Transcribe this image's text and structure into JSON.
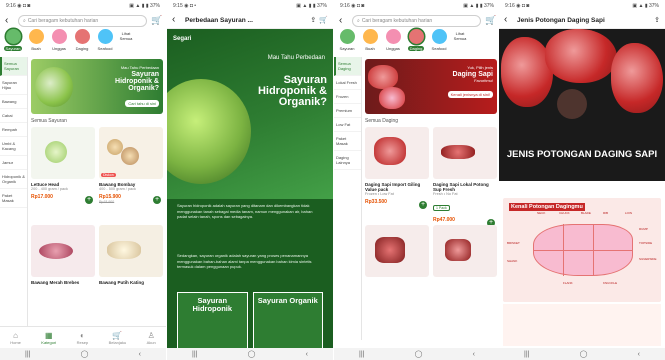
{
  "screens": [
    {
      "status": {
        "time": "9:16 ◉ ◘ ◙",
        "icons": "▣ ▲ ▮ ▮ 37%"
      },
      "search": {
        "placeholder": "Cari beragam kebutuhan harian"
      },
      "categories": [
        {
          "label": "Sayuran",
          "color": "#66bb6a",
          "selected": true
        },
        {
          "label": "Buah",
          "color": "#ffb74d",
          "selected": false
        },
        {
          "label": "Unggas",
          "color": "#f48fb1",
          "selected": false
        },
        {
          "label": "Daging",
          "color": "#e57373",
          "selected": false
        },
        {
          "label": "Seafood",
          "color": "#4fc3f7",
          "selected": false
        }
      ],
      "categories_more": "Lihat Semua",
      "sidebar": [
        "Semua Sayuran",
        "Sayuran Hijau",
        "Bawang",
        "Cabai",
        "Rempah",
        "Umbi & Kacang",
        "Jamur",
        "Hidroponik & Organik",
        "Paket Masak"
      ],
      "banner": {
        "l1": "Mau Tahu Perbedaan",
        "l2": "Sayuran Hidroponik & Organik?",
        "btn": "Cari tahu di sini"
      },
      "section": "Semua Sayuran",
      "products": [
        {
          "name": "Lettuce Head",
          "weight": "200 - 400 gram / pack",
          "price": "Rp17.000",
          "old": "",
          "tag": ""
        },
        {
          "name": "Bawang Bombay",
          "weight": "400 - 500 gram / pack",
          "price": "Rp15.900",
          "old": "Rp18.900",
          "tag": "Diskon"
        },
        {
          "name": "Bawang Merah Brebes",
          "weight": "",
          "price": "",
          "old": "",
          "tag": ""
        },
        {
          "name": "Bawang Putih Kating",
          "weight": "",
          "price": "",
          "old": "",
          "tag": ""
        }
      ],
      "bottomnav": [
        {
          "label": "Home",
          "icon": "⌂"
        },
        {
          "label": "Kategori",
          "icon": "▦"
        },
        {
          "label": "Resep",
          "icon": "◐"
        },
        {
          "label": "Belanjaku",
          "icon": "🛒"
        },
        {
          "label": "Akun",
          "icon": "♙"
        }
      ]
    },
    {
      "status": {
        "time": "9:15 ◉ ◘ •",
        "icons": "▣ ▲ ▮ ▮ 37%"
      },
      "title": "Perbedaan Sayuran ...",
      "logo": "Segari",
      "hero_small": "Mau Tahu Perbedaan",
      "hero_big": "Sayuran Hidroponik & Organik?",
      "para1": "Sayuran hidroponik adalah sayuran yang ditanam dan dikembangkan tidak menggunakan tanah sebagai media tanam, namun menggunakan air, bahan padat selain tanah, spons dan sebagainya.",
      "para2": "Sedangkan, sayuran organik adalah sayuran yang proses penanamannya menggunakan bahan-bahan alami tanpa menggunakan bahan kimia sintetis termasuk dalam penggunaan pupuk.",
      "cmp_left": "Sayuran Hidroponik",
      "cmp_right": "Sayuran Organik"
    },
    {
      "status": {
        "time": "9:16 ◉ ◘ ◙",
        "icons": "▣ ▲ ▮ ▮ 37%"
      },
      "search": {
        "placeholder": "Cari beragam kebutuhan harian"
      },
      "categories": [
        {
          "label": "Sayuran",
          "color": "#66bb6a",
          "selected": false
        },
        {
          "label": "Buah",
          "color": "#ffb74d",
          "selected": false
        },
        {
          "label": "Unggas",
          "color": "#f48fb1",
          "selected": false
        },
        {
          "label": "Daging",
          "color": "#e57373",
          "selected": true
        },
        {
          "label": "Seafood",
          "color": "#4fc3f7",
          "selected": false
        }
      ],
      "categories_more": "Lihat Semua",
      "sidebar": [
        "Semua Daging",
        "Lokal Fresh",
        "Frozen",
        "Premium",
        "Low Fat",
        "Paket Masak",
        "Daging Lainnya"
      ],
      "banner": {
        "l1": "Yuk, Pilih jenis",
        "l2": "Daging Sapi",
        "l3": "Favoritmu!",
        "btn": "Kenali jenisnya di sini!"
      },
      "section": "Semua Daging",
      "products": [
        {
          "name": "Daging Sapi Import Giling Value pack",
          "weight": "Frozen • Low Fat",
          "price": "Rp33.500",
          "old": "",
          "tag": ""
        },
        {
          "name": "Daging Sapi Lokal Potong Sup Fresh",
          "weight": "Fresh • No Fat",
          "price": "Rp47.000",
          "old": "",
          "tag": "1 Pack"
        },
        {
          "name": "",
          "weight": "",
          "price": "",
          "old": "",
          "tag": ""
        },
        {
          "name": "",
          "weight": "",
          "price": "",
          "old": "",
          "tag": ""
        }
      ],
      "bottomnav": [
        {
          "label": "Home",
          "icon": "⌂"
        },
        {
          "label": "Kategori",
          "icon": "▦"
        },
        {
          "label": "Resep",
          "icon": "◐"
        },
        {
          "label": "Belanjaku",
          "icon": "🛒"
        },
        {
          "label": "Akun",
          "icon": "♙"
        }
      ]
    },
    {
      "status": {
        "time": "9:16 ◉ ◘ ◙",
        "icons": "▣ ▲ ▮ 37%"
      },
      "title": "Jenis Potongan Daging Sapi",
      "hero_title": "JENIS POTONGAN DAGING SAPI",
      "diagram_title": "Kenali Potongan Dagingmu",
      "cuts": [
        "NECK",
        "CHUCK",
        "BLADE",
        "RIB",
        "LOIN",
        "RUMP",
        "TOPSIDE",
        "BRISKET",
        "SHANK",
        "FLANK",
        "SILVERSIDE",
        "KNUCKLE"
      ]
    }
  ],
  "system_nav": [
    "|||",
    "◯",
    "‹"
  ],
  "colors": {
    "primary_green": "#2e7d32",
    "price_orange": "#e65100",
    "meat_red": "#c62828"
  }
}
